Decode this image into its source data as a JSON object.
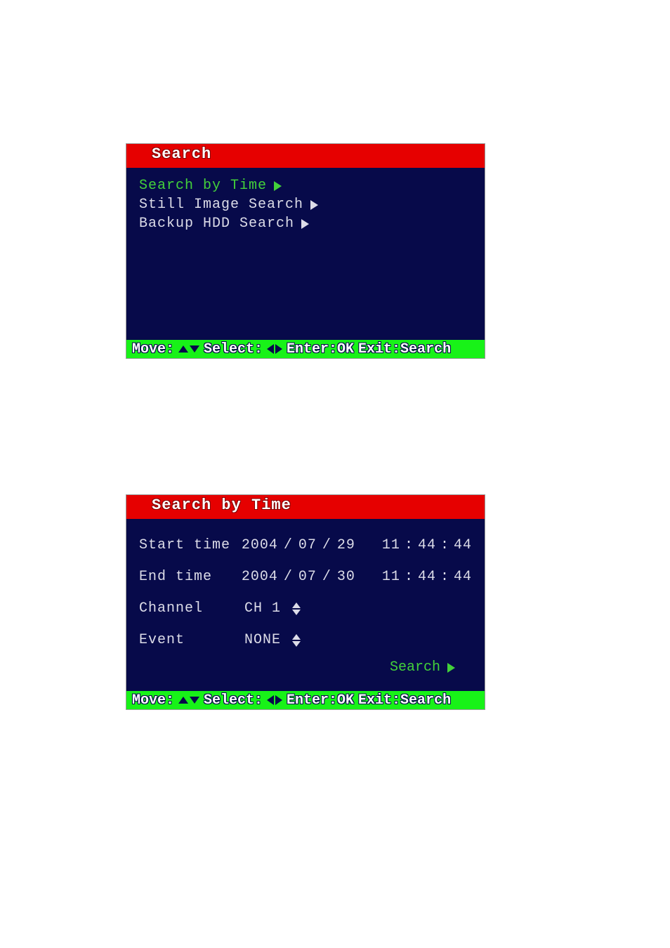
{
  "panel1": {
    "title": "Search",
    "items": [
      {
        "label": "Search by Time",
        "selected": true
      },
      {
        "label": "Still Image Search",
        "selected": false
      },
      {
        "label": "Backup HDD Search",
        "selected": false
      }
    ]
  },
  "panel2": {
    "title": "Search by Time",
    "rows": {
      "start": {
        "label": "Start time",
        "year": "2004",
        "month": "07",
        "day": "29",
        "hour": "11",
        "min": "44",
        "sec": "44"
      },
      "end": {
        "label": "End time",
        "year": "2004",
        "month": "07",
        "day": "30",
        "hour": "11",
        "min": "44",
        "sec": "44"
      },
      "channel": {
        "label": "Channel",
        "value": "CH 1"
      },
      "event": {
        "label": "Event",
        "value": "NONE"
      }
    },
    "action": "Search"
  },
  "help": {
    "move": "Move:",
    "select": "Select:",
    "enter": "Enter:OK",
    "exit": "Exit:Search"
  }
}
